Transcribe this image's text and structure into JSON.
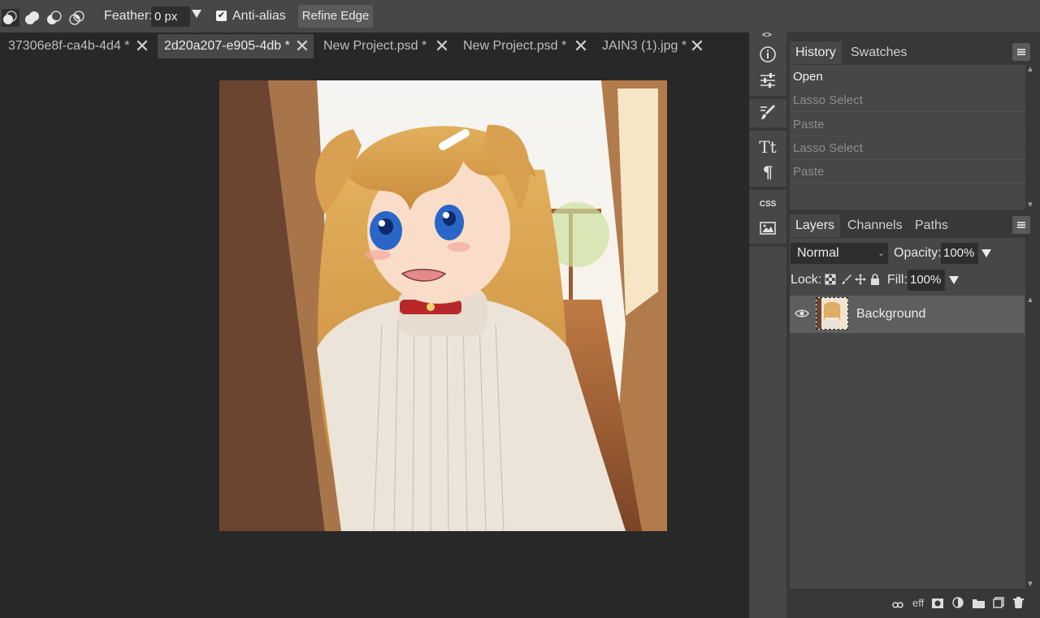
{
  "options_bar": {
    "selection_modes": [
      "new-selection-icon",
      "add-to-selection-icon",
      "subtract-from-selection-icon",
      "intersect-selection-icon"
    ],
    "feather_label": "Feather:",
    "feather_value": "0 px",
    "antialias_label": "Anti-alias",
    "antialias_checked": true,
    "refine_edge_label": "Refine Edge"
  },
  "tabs": [
    {
      "label": "37306e8f-ca4b-4d4",
      "modified": "*",
      "active": false
    },
    {
      "label": "2d20a207-e905-4db",
      "modified": "*",
      "active": true
    },
    {
      "label": "New Project.psd",
      "modified": "*",
      "active": false
    },
    {
      "label": "New Project.psd",
      "modified": "*",
      "active": false
    },
    {
      "label": "JAIN3 (1).jpg",
      "modified": "*",
      "active": false
    }
  ],
  "tab_close_glyph": "✕",
  "toolstrip": {
    "collapse_label": "<>",
    "expand_label": "><",
    "tools": [
      "info-icon",
      "adjustments-icon",
      "brush-settings-icon",
      "character-icon",
      "paragraph-icon",
      "css-icon",
      "image-icon"
    ],
    "css_label": "CSS",
    "character_label": "Tt",
    "paragraph_label": "¶"
  },
  "history_panel": {
    "tabs": [
      "History",
      "Swatches"
    ],
    "items": [
      {
        "label": "Open",
        "state": "active"
      },
      {
        "label": "Lasso Select",
        "state": "future"
      },
      {
        "label": "Paste",
        "state": "future"
      },
      {
        "label": "Lasso Select",
        "state": "future"
      },
      {
        "label": "Paste",
        "state": "future"
      }
    ]
  },
  "layers_panel": {
    "tabs": [
      "Layers",
      "Channels",
      "Paths"
    ],
    "blend_mode": "Normal",
    "opacity_label": "Opacity:",
    "opacity_value": "100%",
    "lock_label": "Lock:",
    "fill_label": "Fill:",
    "fill_value": "100%",
    "layers": [
      {
        "name": "Background",
        "visible": true
      }
    ],
    "bottom_icons": [
      "link-layers-icon",
      "effects-icon",
      "mask-icon",
      "adjustment-layer-icon",
      "new-group-icon",
      "new-layer-icon",
      "delete-layer-icon"
    ],
    "effects_label": "eff"
  },
  "colors": {
    "panel_bg": "#383838",
    "toolbar_bg": "#474747",
    "workspace_bg": "#282828",
    "selected_layer": "#5e5e5e"
  }
}
